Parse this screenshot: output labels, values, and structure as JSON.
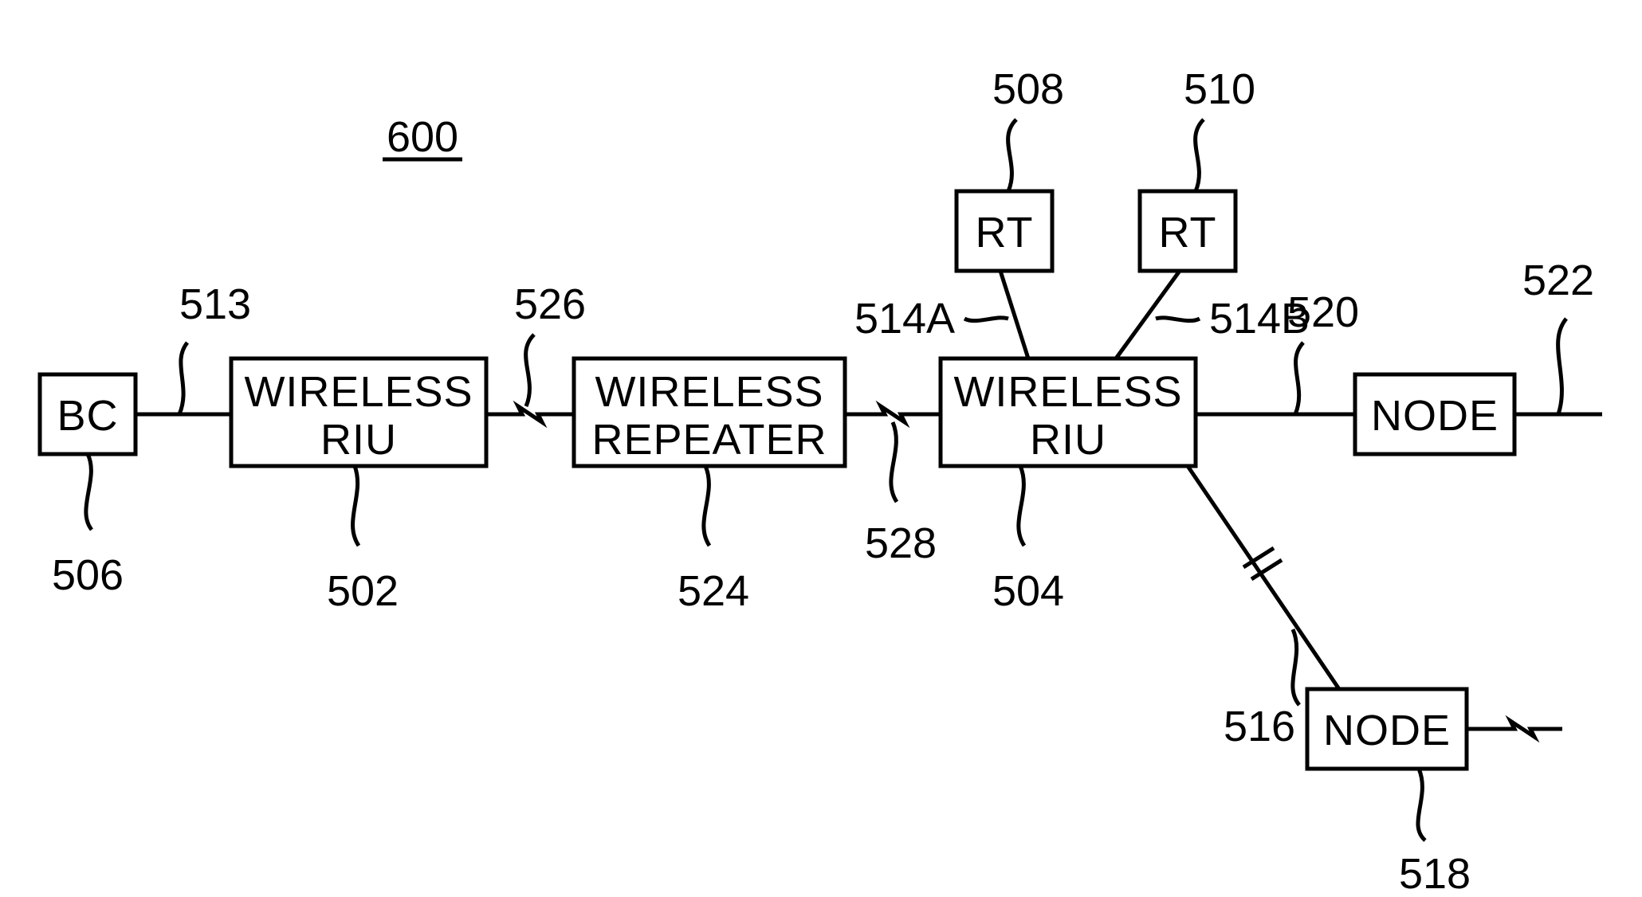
{
  "figure_ref": "600",
  "boxes": {
    "bc": {
      "label": "BC"
    },
    "riu1_line1": {
      "label": "WIRELESS"
    },
    "riu1_line2": {
      "label": "RIU"
    },
    "rep_line1": {
      "label": "WIRELESS"
    },
    "rep_line2": {
      "label": "REPEATER"
    },
    "riu2_line1": {
      "label": "WIRELESS"
    },
    "riu2_line2": {
      "label": "RIU"
    },
    "rt1": {
      "label": "RT"
    },
    "rt2": {
      "label": "RT"
    },
    "node_top": {
      "label": "NODE"
    },
    "node_bot": {
      "label": "NODE"
    }
  },
  "refs": {
    "r600": "600",
    "r506": "506",
    "r513": "513",
    "r502": "502",
    "r526": "526",
    "r524": "524",
    "r528": "528",
    "r504": "504",
    "r508": "508",
    "r514A": "514A",
    "r510": "510",
    "r514B": "514B",
    "r520": "520",
    "r522": "522",
    "r516": "516",
    "r518": "518"
  }
}
